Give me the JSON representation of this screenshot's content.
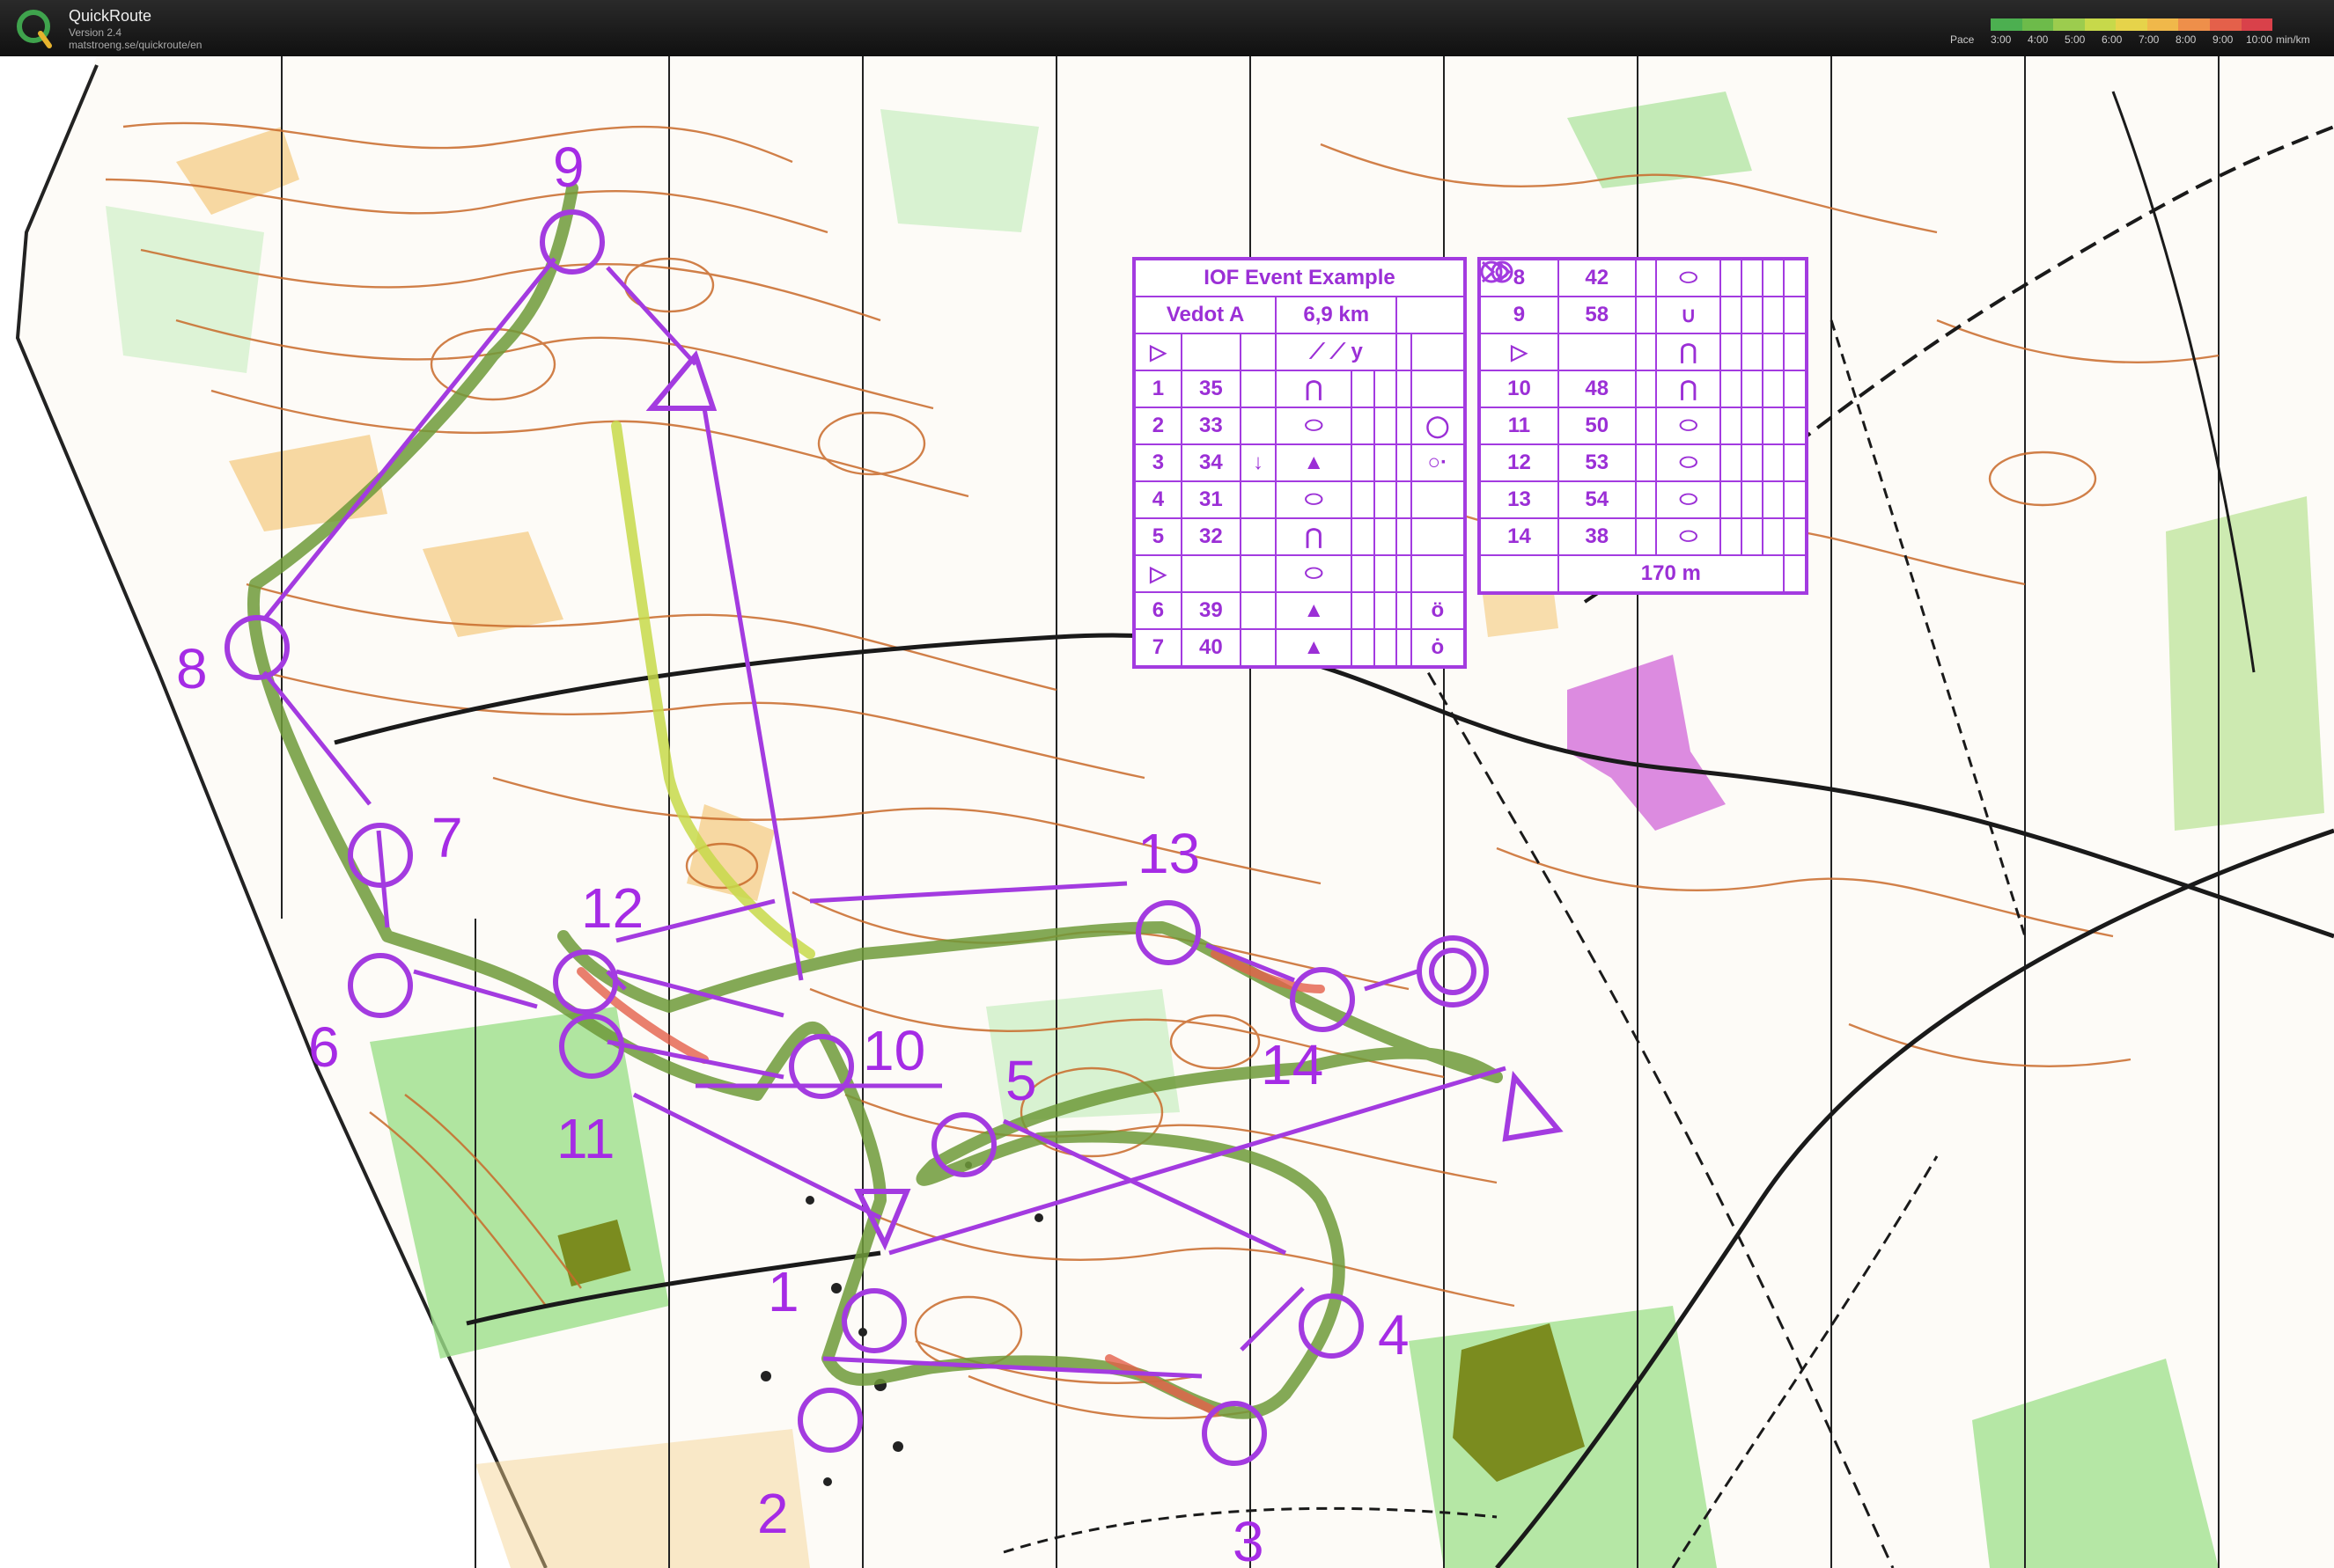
{
  "app": {
    "name": "QuickRoute",
    "version": "Version 2.4",
    "url": "matstroeng.se/quickroute/en"
  },
  "pace_scale": {
    "label": "Pace",
    "ticks": [
      "3:00",
      "4:00",
      "5:00",
      "6:00",
      "7:00",
      "8:00",
      "9:00",
      "10:00"
    ],
    "unit": "min/km",
    "colors": [
      "#4caf50",
      "#6dbb4a",
      "#9ccc4e",
      "#c7d94a",
      "#e6d34a",
      "#f0b84a",
      "#ee8f4a",
      "#e4604a",
      "#d9414a"
    ]
  },
  "course": {
    "title": "IOF Event Example",
    "class": "Vedot A",
    "length": "6,9 km",
    "final_leg_distance": "170 m",
    "legs_left": [
      {
        "num": "1",
        "code": "35",
        "d": "",
        "e": "⋂",
        "f": ""
      },
      {
        "num": "2",
        "code": "33",
        "d": "",
        "e": "⬭",
        "f": "◯"
      },
      {
        "num": "3",
        "code": "34",
        "d": "↓",
        "e": "▲",
        "f": "○·"
      },
      {
        "num": "4",
        "code": "31",
        "d": "",
        "e": "⬭",
        "f": ""
      },
      {
        "num": "5",
        "code": "32",
        "d": "",
        "e": "⋂",
        "f": ""
      },
      {
        "num": "6",
        "code": "39",
        "d": "",
        "e": "▲",
        "f": "ö"
      },
      {
        "num": "7",
        "code": "40",
        "d": "",
        "e": "▲",
        "f": "ȯ"
      }
    ],
    "legs_right": [
      {
        "num": "8",
        "code": "42",
        "e": "⬭"
      },
      {
        "num": "9",
        "code": "58",
        "e": "∪"
      },
      {
        "num": "10",
        "code": "48",
        "e": "⋂"
      },
      {
        "num": "11",
        "code": "50",
        "e": "⬭"
      },
      {
        "num": "12",
        "code": "53",
        "e": "⬭"
      },
      {
        "num": "13",
        "code": "54",
        "e": "⬭"
      },
      {
        "num": "14",
        "code": "38",
        "e": "⬭"
      }
    ],
    "start_symbol": "▷",
    "mid_symbol": "⬭",
    "header_symbols": "⟋ ⟋ y",
    "controls": [
      {
        "label": "1"
      },
      {
        "label": "2"
      },
      {
        "label": "3"
      },
      {
        "label": "4"
      },
      {
        "label": "5"
      },
      {
        "label": "6"
      },
      {
        "label": "7"
      },
      {
        "label": "8"
      },
      {
        "label": "9"
      },
      {
        "label": "10"
      },
      {
        "label": "11"
      },
      {
        "label": "12"
      },
      {
        "label": "13"
      },
      {
        "label": "14"
      }
    ]
  },
  "colors": {
    "course_purple": "#a33be0",
    "contour_brown": "#c96a2a",
    "vegetation_green": "#9ce08a",
    "open_yellow": "#f5d08c",
    "route_line": "#6f9a3a"
  }
}
